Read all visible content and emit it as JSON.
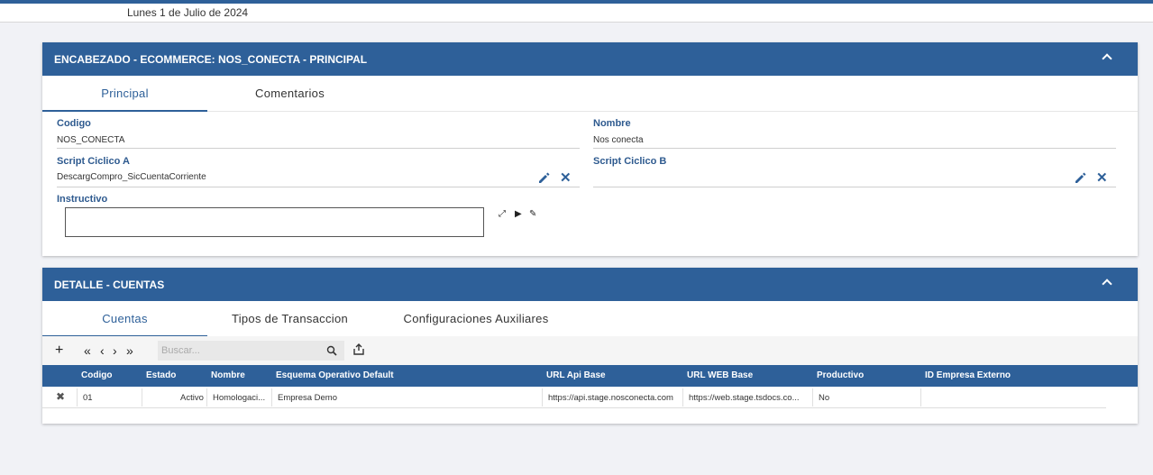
{
  "date_text": "Lunes 1 de Julio de 2024",
  "header_card": {
    "title": "ENCABEZADO - ECOMMERCE: NOS_CONECTA - PRINCIPAL",
    "tabs": [
      "Principal",
      "Comentarios"
    ],
    "fields": {
      "codigo_label": "Codigo",
      "codigo_value": "NOS_CONECTA",
      "nombre_label": "Nombre",
      "nombre_value": "Nos conecta",
      "script_a_label": "Script Ciclico A",
      "script_a_value": "DescargCompro_SicCuentaCorriente",
      "script_b_label": "Script Ciclico B",
      "script_b_value": "",
      "instructivo_label": "Instructivo"
    }
  },
  "detail_card": {
    "title": "DETALLE - CUENTAS",
    "tabs": [
      "Cuentas",
      "Tipos de Transaccion",
      "Configuraciones Auxiliares"
    ],
    "search_placeholder": "Buscar...",
    "columns": [
      "Codigo",
      "Estado",
      "Nombre",
      "Esquema Operativo Default",
      "URL Api Base",
      "URL WEB Base",
      "Productivo",
      "ID Empresa Externo"
    ],
    "rows": [
      [
        "01",
        "Activo",
        "Homologaci...",
        "Empresa Demo",
        "https://api.stage.nosconecta.com",
        "https://web.stage.tsdocs.co...",
        "No",
        ""
      ]
    ]
  },
  "colors": {
    "primary": "#2e6099",
    "label": "#2e5a8f",
    "background": "#f1f2f6"
  }
}
